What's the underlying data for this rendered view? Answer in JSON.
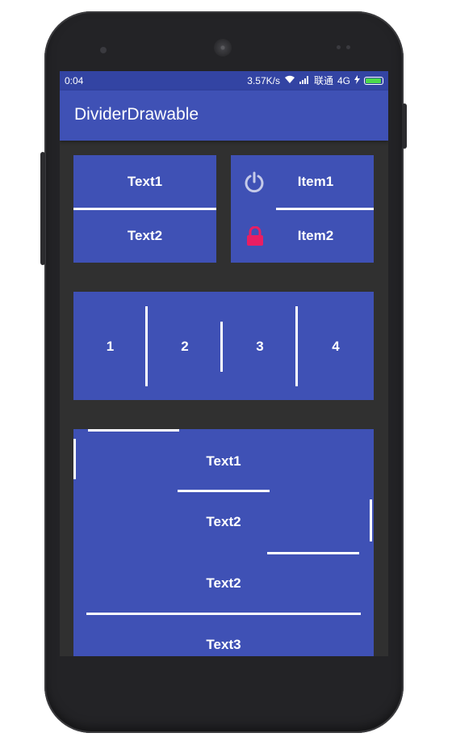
{
  "status_bar": {
    "time": "0:04",
    "network_speed": "3.57K/s",
    "carrier": "联通",
    "network_type": "4G",
    "battery_level": 0.95
  },
  "app_bar": {
    "title": "DividerDrawable"
  },
  "card1": {
    "items": [
      "Text1",
      "Text2"
    ]
  },
  "card2": {
    "items": [
      {
        "label": "Item1",
        "icon": "power-icon"
      },
      {
        "label": "Item2",
        "icon": "lock-icon"
      }
    ]
  },
  "card3": {
    "items": [
      "1",
      "2",
      "3",
      "4"
    ]
  },
  "card4": {
    "items": [
      "Text1",
      "Text2",
      "Text2",
      "Text3"
    ]
  },
  "colors": {
    "primary": "#3f51b5",
    "primary_dark": "#3344a3",
    "background": "#303030",
    "lock_icon": "#e91e63",
    "power_icon": "#c5cae9"
  }
}
